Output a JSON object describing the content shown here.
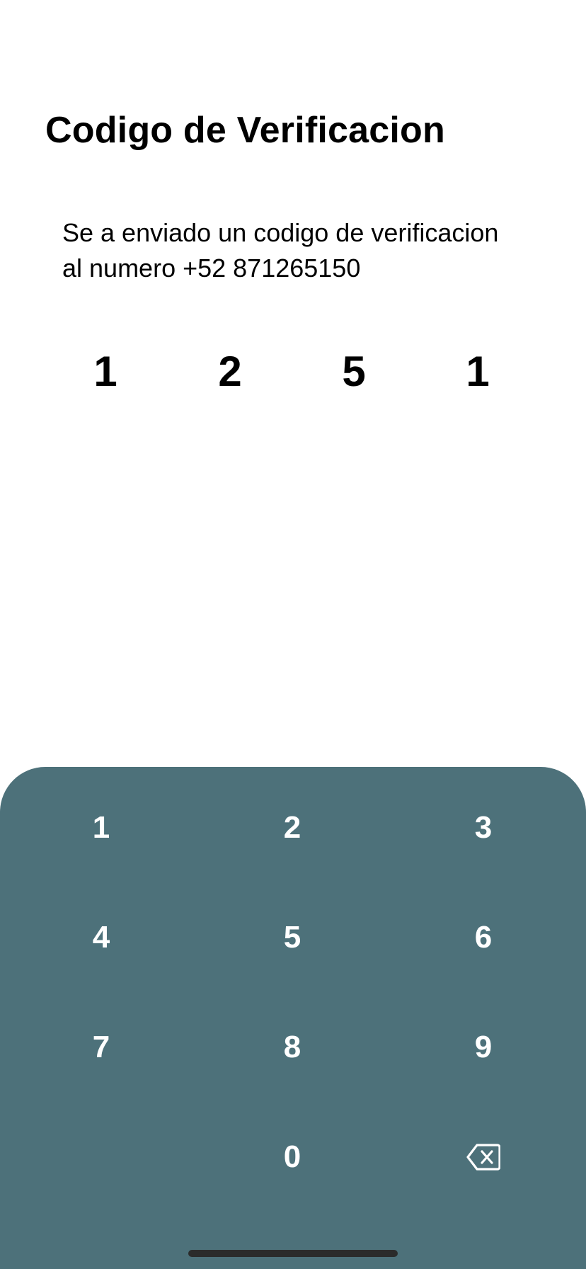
{
  "header": {
    "title": "Codigo de Verificacion"
  },
  "message": {
    "line1": "Se a enviado un codigo de verificacion",
    "line2": "al numero  +52 871265150"
  },
  "code": {
    "digits": [
      "1",
      "2",
      "5",
      "1"
    ]
  },
  "keypad": {
    "keys": [
      "1",
      "2",
      "3",
      "4",
      "5",
      "6",
      "7",
      "8",
      "9",
      "",
      "0"
    ],
    "backspace_icon": "backspace-icon"
  },
  "colors": {
    "keypad_background": "#4d717a",
    "key_text": "#ffffff",
    "text": "#000000"
  }
}
